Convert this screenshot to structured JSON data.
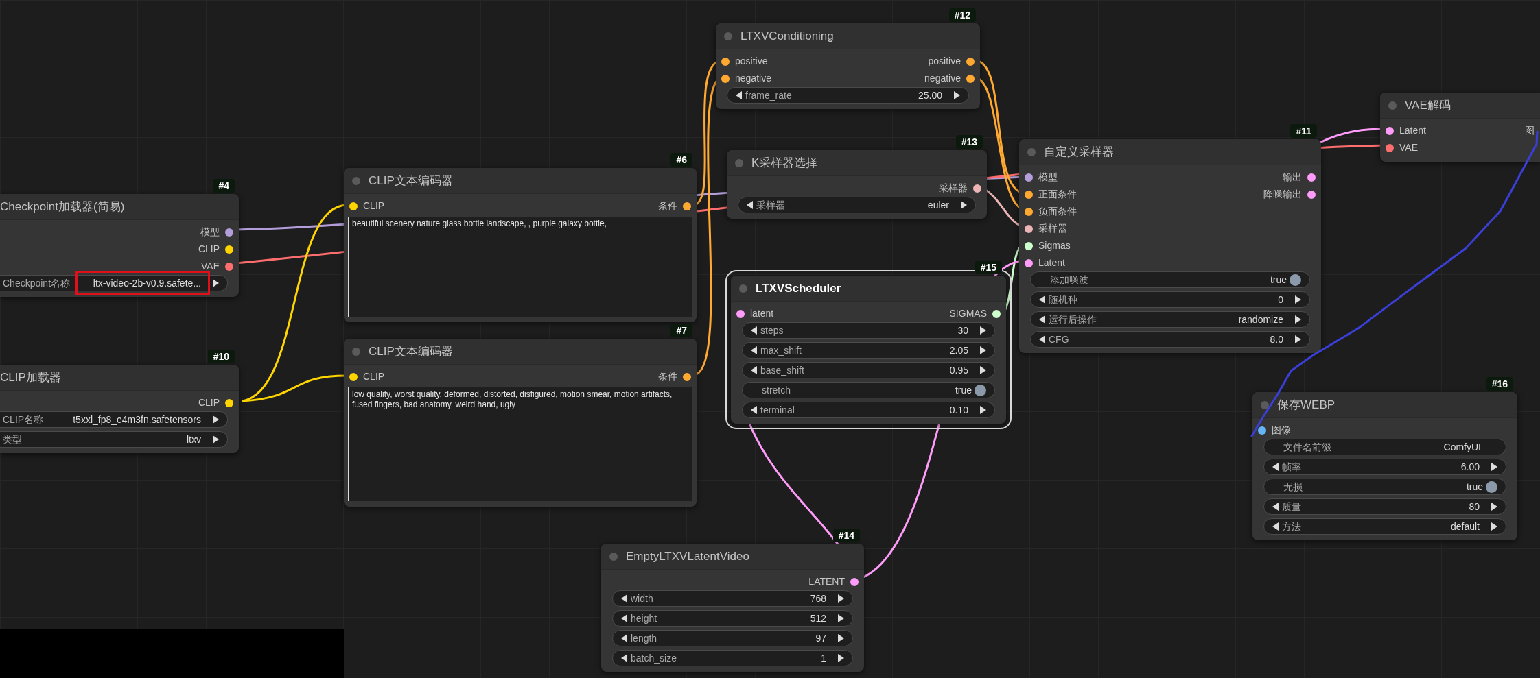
{
  "nodes": [
    {
      "id": "#4",
      "title": "Checkpoint加载器(简易)",
      "selected": false,
      "cut_left": true,
      "outputs": [
        {
          "label": "模型",
          "color": "#b39ddb"
        },
        {
          "label": "CLIP",
          "color": "#ffd500"
        },
        {
          "label": "VAE",
          "color": "#ff6e6e"
        }
      ],
      "widgets": [
        {
          "kind": "combo",
          "label": "Checkpoint名称",
          "value": "ltx-video-2b-v0.9.safete...",
          "highlighted": true
        }
      ]
    },
    {
      "id": "#10",
      "title": "CLIP加载器",
      "selected": false,
      "cut_left": true,
      "outputs": [
        {
          "label": "CLIP",
          "color": "#ffd500"
        }
      ],
      "widgets": [
        {
          "kind": "combo",
          "label": "CLIP名称",
          "value": "t5xxl_fp8_e4m3fn.safetensors",
          "highlighted": false
        },
        {
          "kind": "combo",
          "label": "类型",
          "value": "ltxv",
          "highlighted": false
        }
      ]
    },
    {
      "id": "#6",
      "title": "CLIP文本编码器",
      "selected": false,
      "inputs": [
        {
          "label": "CLIP",
          "color": "#ffd500"
        }
      ],
      "outputs": [
        {
          "label": "条件",
          "color": "#ffa931"
        }
      ],
      "widgets": [
        {
          "kind": "textarea",
          "value": "beautiful scenery nature glass bottle landscape, , purple galaxy bottle,"
        }
      ]
    },
    {
      "id": "#7",
      "title": "CLIP文本编码器",
      "selected": false,
      "inputs": [
        {
          "label": "CLIP",
          "color": "#ffd500"
        }
      ],
      "outputs": [
        {
          "label": "条件",
          "color": "#ffa931"
        }
      ],
      "widgets": [
        {
          "kind": "textarea",
          "value": "low quality, worst quality, deformed, distorted, disfigured, motion smear, motion artifacts, fused fingers, bad anatomy, weird hand, ugly"
        }
      ]
    },
    {
      "id": "#12",
      "title": "LTXVConditioning",
      "selected": false,
      "inputs": [
        {
          "label": "positive",
          "color": "#ffa931"
        },
        {
          "label": "negative",
          "color": "#ffa931"
        }
      ],
      "outputs": [
        {
          "label": "positive",
          "color": "#ffa931"
        },
        {
          "label": "negative",
          "color": "#ffa931"
        }
      ],
      "widgets": [
        {
          "kind": "number",
          "label": "frame_rate",
          "value": "25.00"
        }
      ]
    },
    {
      "id": "#13",
      "title": "K采样器选择",
      "selected": false,
      "outputs": [
        {
          "label": "采样器",
          "color": "#ecb4b4"
        }
      ],
      "widgets": [
        {
          "kind": "combo",
          "label": "采样器",
          "value": "euler"
        }
      ]
    },
    {
      "id": "#15",
      "title": "LTXVScheduler",
      "selected": true,
      "inputs": [
        {
          "label": "latent",
          "color": "#ff9cf9"
        }
      ],
      "outputs": [
        {
          "label": "SIGMAS",
          "color": "#cdffcd"
        }
      ],
      "widgets": [
        {
          "kind": "number",
          "label": "steps",
          "value": "30"
        },
        {
          "kind": "number",
          "label": "max_shift",
          "value": "2.05"
        },
        {
          "kind": "number",
          "label": "base_shift",
          "value": "0.95"
        },
        {
          "kind": "toggle",
          "label": "stretch",
          "value": "true",
          "on": true
        },
        {
          "kind": "number",
          "label": "terminal",
          "value": "0.10"
        }
      ]
    },
    {
      "id": "#11",
      "title": "自定义采样器",
      "selected": false,
      "inputs": [
        {
          "label": "模型",
          "color": "#b39ddb"
        },
        {
          "label": "正面条件",
          "color": "#ffa931"
        },
        {
          "label": "负面条件",
          "color": "#ffa931"
        },
        {
          "label": "采样器",
          "color": "#ecb4b4"
        },
        {
          "label": "Sigmas",
          "color": "#cdffcd"
        },
        {
          "label": "Latent",
          "color": "#ff9cf9"
        }
      ],
      "outputs": [
        {
          "label": "输出",
          "color": "#ff9cf9"
        },
        {
          "label": "降噪输出",
          "color": "#ff9cf9"
        }
      ],
      "widgets": [
        {
          "kind": "toggle",
          "label": "添加噪波",
          "value": "true",
          "on": true
        },
        {
          "kind": "number",
          "label": "随机种",
          "value": "0"
        },
        {
          "kind": "combo",
          "label": "运行后操作",
          "value": "randomize"
        },
        {
          "kind": "number",
          "label": "CFG",
          "value": "8.0"
        }
      ]
    },
    {
      "id": "#14",
      "title": "EmptyLTXVLatentVideo",
      "selected": false,
      "outputs": [
        {
          "label": "LATENT",
          "color": "#ff9cf9"
        }
      ],
      "widgets": [
        {
          "kind": "number",
          "label": "width",
          "value": "768"
        },
        {
          "kind": "number",
          "label": "height",
          "value": "512"
        },
        {
          "kind": "number",
          "label": "length",
          "value": "97"
        },
        {
          "kind": "number",
          "label": "batch_size",
          "value": "1"
        }
      ]
    },
    {
      "title": "VAE解码",
      "selected": false,
      "cut_right": true,
      "inputs": [
        {
          "label": "Latent",
          "color": "#ff9cf9"
        },
        {
          "label": "VAE",
          "color": "#ff6e6e"
        }
      ],
      "outputs": [
        {
          "label": "图"
        }
      ]
    },
    {
      "id": "#16",
      "title": "保存WEBP",
      "selected": false,
      "inputs": [
        {
          "label": "图像",
          "color": "#64b5f6"
        }
      ],
      "widgets": [
        {
          "kind": "text",
          "label": "文件名前缀",
          "value": "ComfyUI"
        },
        {
          "kind": "number",
          "label": "帧率",
          "value": "6.00"
        },
        {
          "kind": "toggle",
          "label": "无损",
          "value": "true",
          "on": true
        },
        {
          "kind": "number",
          "label": "质量",
          "value": "80"
        },
        {
          "kind": "combo",
          "label": "方法",
          "value": "default"
        }
      ]
    }
  ]
}
